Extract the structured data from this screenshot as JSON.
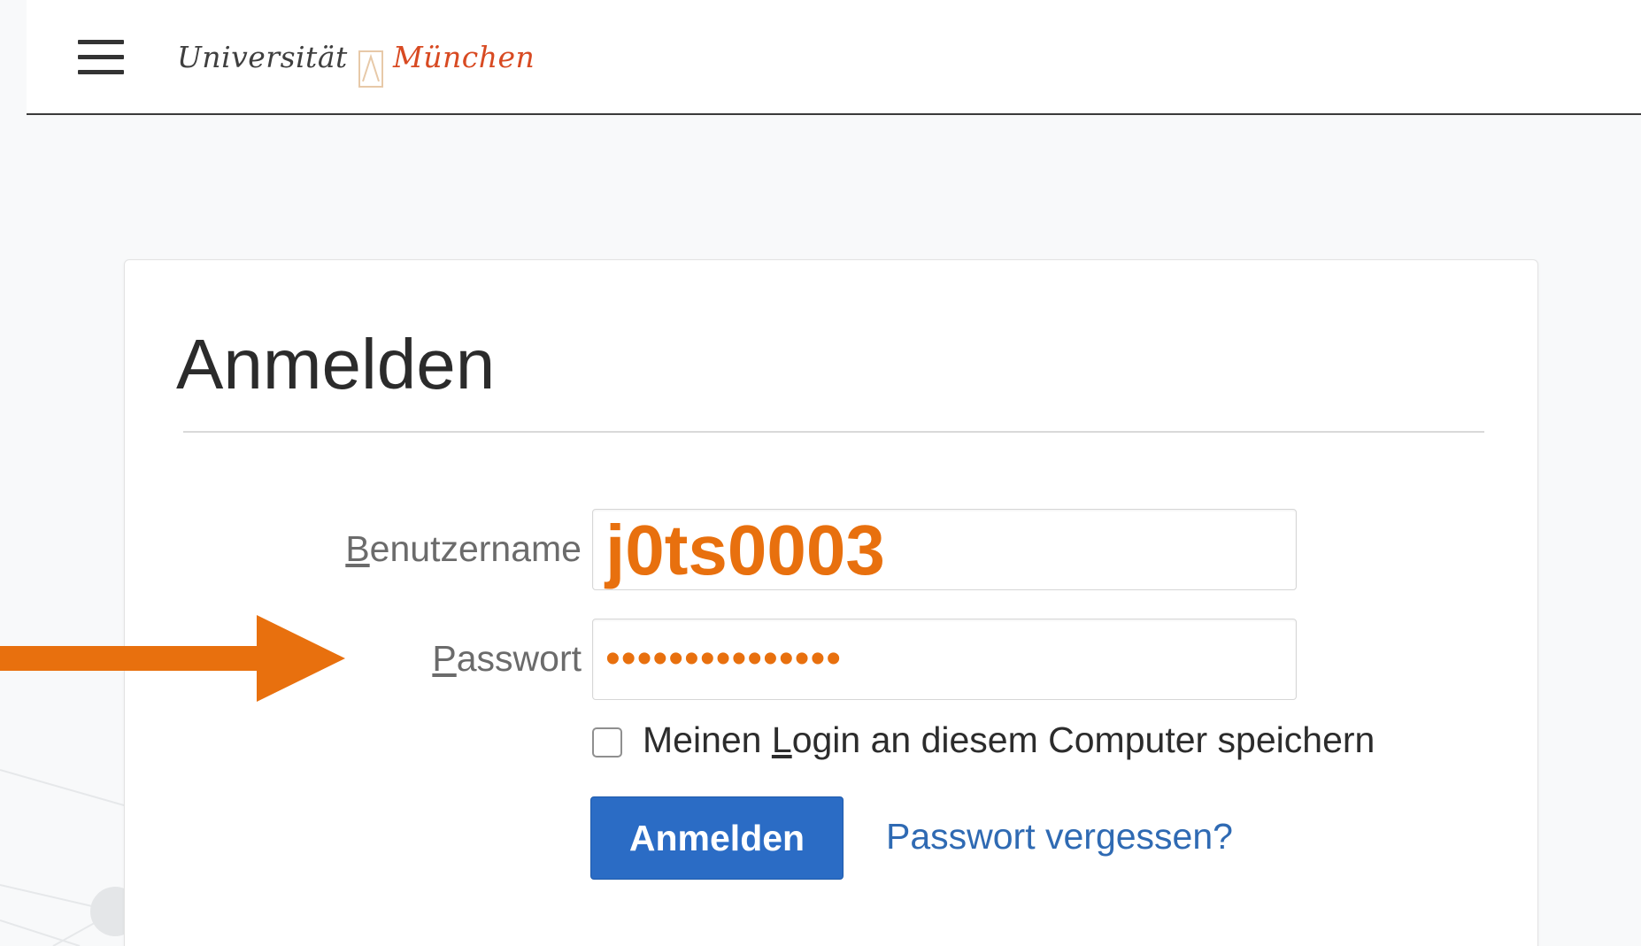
{
  "header": {
    "menu_icon": "hamburger-icon",
    "logo": {
      "word1": "Universität",
      "word2": "München"
    }
  },
  "login": {
    "title": "Anmelden",
    "username_label_first": "B",
    "username_label_rest": "enutzername",
    "username_value": "j0ts0003",
    "password_label_first": "P",
    "password_label_rest": "asswort",
    "password_value": "•••••••••••••••",
    "remember_checked": false,
    "remember_label_before": "Meinen ",
    "remember_label_accel": "L",
    "remember_label_after": "ogin an diesem Computer speichern",
    "submit_label": "Anmelden",
    "forgot_label": "Passwort vergessen?"
  },
  "colors": {
    "accent_orange": "#e8700e",
    "button_blue": "#2b6cc5",
    "link_blue": "#2f6ab3",
    "logo_red": "#d84a22"
  },
  "annotation": {
    "icon": "arrow-right-icon"
  }
}
